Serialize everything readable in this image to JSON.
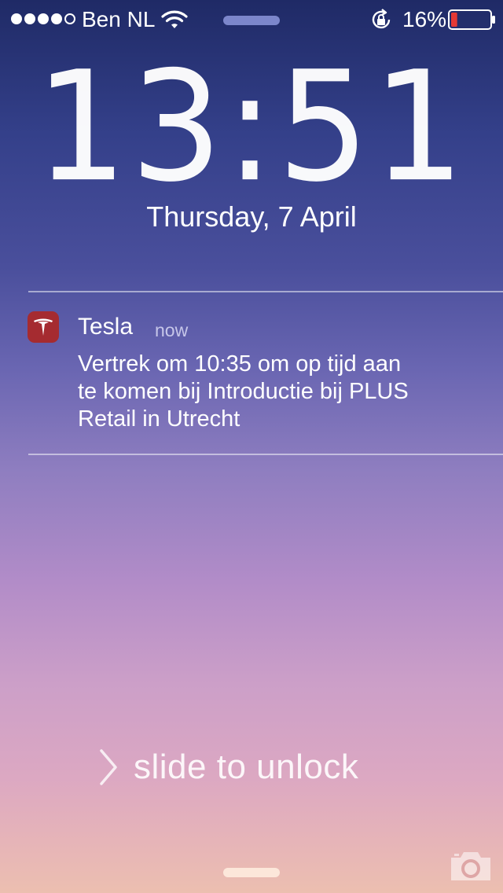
{
  "status_bar": {
    "signal_bars_filled": 4,
    "signal_bars_total": 5,
    "carrier": "Ben NL",
    "wifi_icon": "wifi-icon",
    "lock_rotation_icon": "lock-rotation-icon",
    "battery_percent": "16%",
    "battery_level": 0.16,
    "battery_color": "#e53935"
  },
  "lock_screen": {
    "time": "13:51",
    "date": "Thursday, 7 April"
  },
  "notification": {
    "app_icon": "tesla-logo-icon",
    "app_icon_color": "#a52b30",
    "app_name": "Tesla",
    "time": "now",
    "body_lines": [
      "Vertrek om 10:35 om op tijd aan",
      "te komen bij Introductie bij PLUS",
      "Retail in Utrecht"
    ]
  },
  "unlock": {
    "chevron_icon": "chevron-right-icon",
    "text": "slide to unlock",
    "camera_icon": "camera-icon"
  }
}
